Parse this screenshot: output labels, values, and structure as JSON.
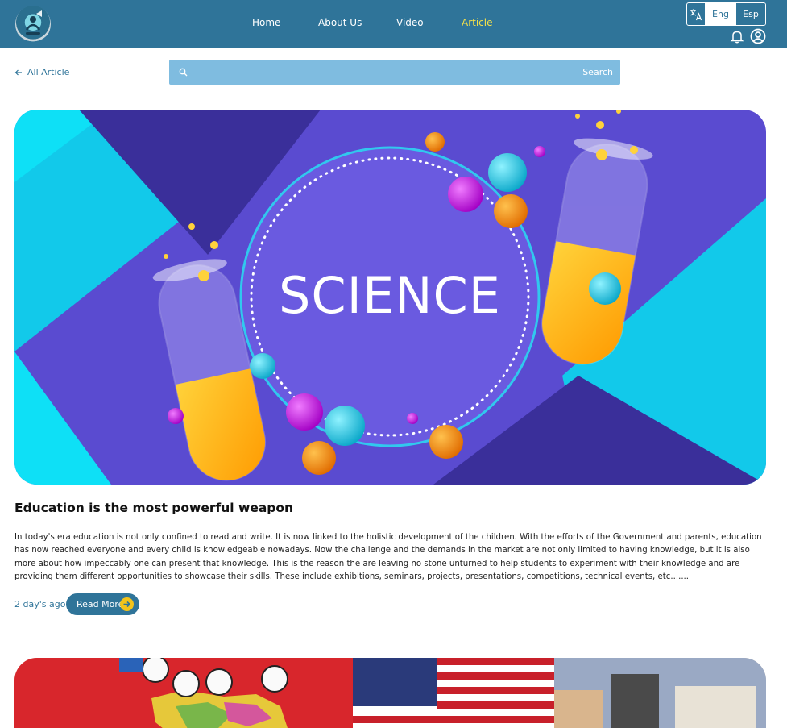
{
  "nav": {
    "items": [
      {
        "label": "Home"
      },
      {
        "label": "About Us"
      },
      {
        "label": "Video"
      },
      {
        "label": "Article",
        "active": true
      }
    ],
    "languages": [
      "Eng",
      "Esp"
    ],
    "selected_language": "Eng",
    "icons": [
      "translate-icon",
      "bell-icon",
      "user-circle-icon"
    ]
  },
  "back_link": {
    "label": "All Article"
  },
  "search": {
    "placeholder": "",
    "button_label": "Search"
  },
  "articles": [
    {
      "image_text": "SCIENCE",
      "title": "Education is the most powerful weapon",
      "body": "In today's era education is not only confined to read and write. It is now linked to the holistic development of the children. With the efforts of the Government and parents, education has now reached everyone and every child is knowledgeable nowadays. Now the challenge and the demands in the market are not only limited to having knowledge, but it is also more about how impeccably one can present that knowledge.  This is the reason the  are leaving no stone unturned to help students to experiment with their knowledge and are providing them different opportunities to showcase their skills. These include exhibitions, seminars, projects, presentations, competitions, technical events, etc.......",
      "time_ago": "2 day's ago",
      "read_more_label": "Read More"
    }
  ],
  "colors": {
    "header": "#2f7499",
    "accent_active": "#f3e04a",
    "search_bar": "#7fbce0",
    "read_more_arrow": "#f3c31a"
  }
}
